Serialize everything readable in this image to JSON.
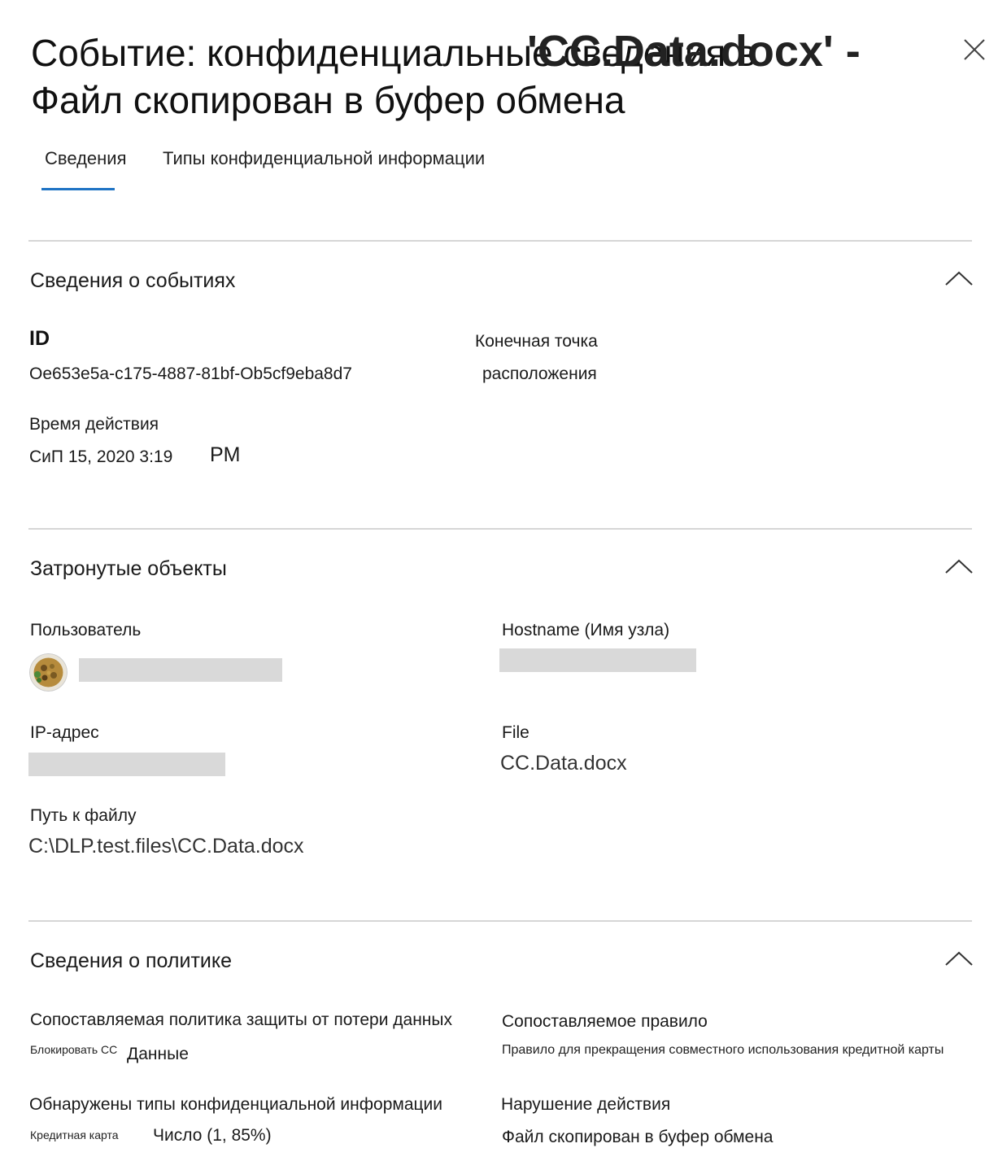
{
  "header": {
    "title": "Событие: конфиденциальные сведения в Файл скопирован в буфер обмена",
    "title_overlay": "'CC.Data.docx' -",
    "close_icon": "close-icon"
  },
  "tabs": [
    {
      "label": "Сведения",
      "selected": true
    },
    {
      "label": "Типы конфиденциальной информации",
      "selected": false
    }
  ],
  "accent_color": "#1f73c4",
  "event_details": {
    "title": "Сведения о событиях",
    "id_label": "ID",
    "id_value": "Oe653e5a-c175-4887-81bf-Ob5cf9eba8d7",
    "endpoint_label": "Конечная точка",
    "location_value": "расположения",
    "time_label": "Время действия",
    "time_value": "СиП 15, 2020 3:19",
    "time_suffix": "PM"
  },
  "affected_objects": {
    "title": "Затронутые объекты",
    "user_label": "Пользователь",
    "hostname_label": "Hostname (Имя узла)",
    "ip_label": "IP-адрес",
    "file_label": "File",
    "file_value": "CC.Data.docx",
    "path_label": "Путь к файлу",
    "path_value": "C:\\DLP.test.files\\CC.Data.docx"
  },
  "policy_details": {
    "title": "Сведения о политике",
    "matched_policy_label": "Сопоставляемая политика защиты от потери данных",
    "matched_policy_small": "Блокировать CC",
    "matched_policy_value": "Данные",
    "matched_rule_label": "Сопоставляемое правило",
    "matched_rule_value": "Правило для прекращения совместного использования кредитной карты",
    "sit_label": "Обнаружены типы конфиденциальной информации",
    "sit_small": "Кредитная карта",
    "sit_value": "Число (1, 85%)",
    "violation_label": "Нарушение действия",
    "violation_value": "Файл скопирован в буфер обмена"
  }
}
